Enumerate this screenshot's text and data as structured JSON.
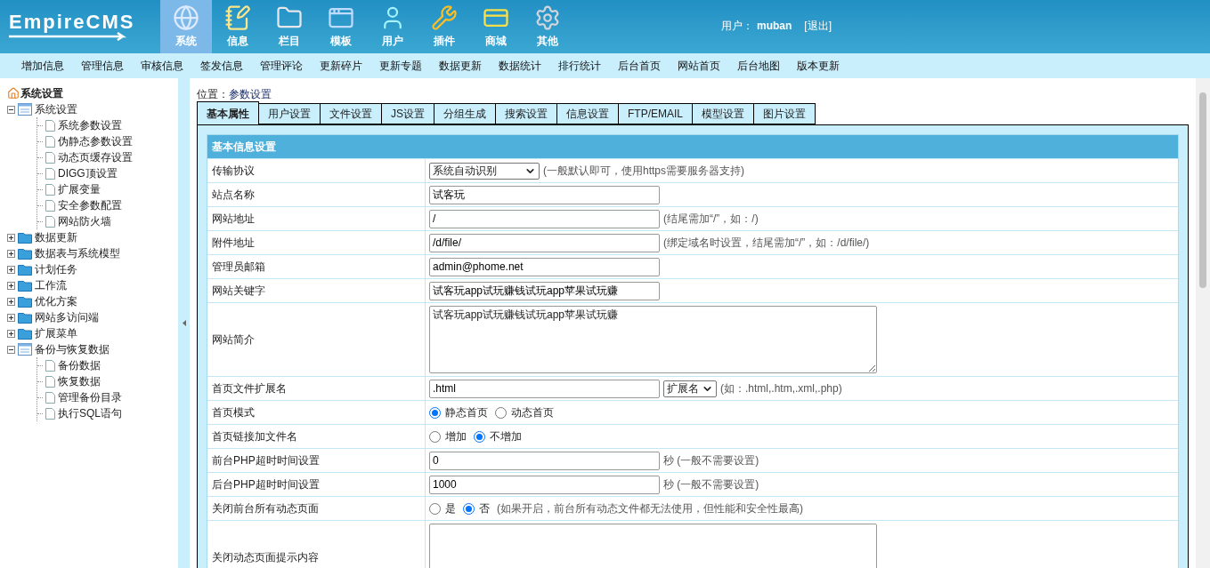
{
  "header": {
    "logo": "EmpireCMS",
    "nav": [
      {
        "label": "系统",
        "selected": true
      },
      {
        "label": "信息",
        "selected": false
      },
      {
        "label": "栏目",
        "selected": false
      },
      {
        "label": "模板",
        "selected": false
      },
      {
        "label": "用户",
        "selected": false
      },
      {
        "label": "插件",
        "selected": false
      },
      {
        "label": "商城",
        "selected": false
      },
      {
        "label": "其他",
        "selected": false
      }
    ],
    "user_label": "用户：",
    "user_name": "muban",
    "logout": "[退出]"
  },
  "submenu": [
    "增加信息",
    "管理信息",
    "审核信息",
    "签发信息",
    "管理评论",
    "更新碎片",
    "更新专题",
    "数据更新",
    "数据统计",
    "排行统计",
    "后台首页",
    "网站首页",
    "后台地图",
    "版本更新"
  ],
  "sidebar": {
    "title": "系统设置",
    "tree": [
      {
        "label": "系统设置",
        "expanded": true,
        "children": [
          {
            "label": "系统参数设置"
          },
          {
            "label": "伪静态参数设置"
          },
          {
            "label": "动态页缓存设置"
          },
          {
            "label": "DIGG顶设置"
          },
          {
            "label": "扩展变量"
          },
          {
            "label": "安全参数配置"
          },
          {
            "label": "网站防火墙"
          }
        ]
      },
      {
        "label": "数据更新",
        "expanded": false
      },
      {
        "label": "数据表与系统模型",
        "expanded": false
      },
      {
        "label": "计划任务",
        "expanded": false
      },
      {
        "label": "工作流",
        "expanded": false
      },
      {
        "label": "优化方案",
        "expanded": false
      },
      {
        "label": "网站多访问端",
        "expanded": false
      },
      {
        "label": "扩展菜单",
        "expanded": false
      },
      {
        "label": "备份与恢复数据",
        "expanded": true,
        "children": [
          {
            "label": "备份数据"
          },
          {
            "label": "恢复数据"
          },
          {
            "label": "管理备份目录"
          },
          {
            "label": "执行SQL语句"
          }
        ]
      }
    ]
  },
  "location": {
    "label": "位置：",
    "value": "参数设置"
  },
  "tabs": [
    {
      "label": "基本属性",
      "selected": true
    },
    {
      "label": "用户设置",
      "selected": false
    },
    {
      "label": "文件设置",
      "selected": false
    },
    {
      "label": "JS设置",
      "selected": false
    },
    {
      "label": "分组生成",
      "selected": false
    },
    {
      "label": "搜索设置",
      "selected": false
    },
    {
      "label": "信息设置",
      "selected": false
    },
    {
      "label": "FTP/EMAIL",
      "selected": false
    },
    {
      "label": "模型设置",
      "selected": false
    },
    {
      "label": "图片设置",
      "selected": false
    }
  ],
  "section_title": "基本信息设置",
  "rows": [
    {
      "kind": "select",
      "label": "传输协议",
      "value": "系统自动识别",
      "hint": "(一般默认即可，使用https需要服务器支持)"
    },
    {
      "kind": "text",
      "label": "站点名称",
      "value": "试客玩"
    },
    {
      "kind": "text",
      "label": "网站地址",
      "value": "/",
      "hint": "(结尾需加“/”，如：/)"
    },
    {
      "kind": "text",
      "label": "附件地址",
      "value": "/d/file/",
      "hint": "(绑定域名时设置，结尾需加“/”，如：/d/file/)"
    },
    {
      "kind": "text",
      "label": "管理员邮箱",
      "value": "admin@phome.net"
    },
    {
      "kind": "text",
      "label": "网站关键字",
      "value": "试客玩app试玩赚钱试玩app苹果试玩赚"
    },
    {
      "kind": "textarea",
      "label": "网站简介",
      "value": "试客玩app试玩赚钱试玩app苹果试玩赚"
    },
    {
      "kind": "text_select",
      "label": "首页文件扩展名",
      "value": ".html",
      "select": "扩展名",
      "hint": "(如：.html,.htm,.xml,.php)"
    },
    {
      "kind": "radio",
      "label": "首页模式",
      "options": [
        {
          "label": "静态首页",
          "selected": true
        },
        {
          "label": "动态首页",
          "selected": false
        }
      ]
    },
    {
      "kind": "radio",
      "label": "首页链接加文件名",
      "options": [
        {
          "label": "增加",
          "selected": false
        },
        {
          "label": "不增加",
          "selected": true
        }
      ]
    },
    {
      "kind": "text",
      "label": "前台PHP超时时间设置",
      "value": "0",
      "hint": "秒 (一般不需要设置)"
    },
    {
      "kind": "text",
      "label": "后台PHP超时时间设置",
      "value": "1000",
      "hint": "秒 (一般不需要设置)"
    },
    {
      "kind": "radio",
      "label": "关闭前台所有动态页面",
      "options": [
        {
          "label": "是",
          "selected": false
        },
        {
          "label": "否",
          "selected": true
        }
      ],
      "hint": "(如果开启，前台所有动态文件都无法使用，但性能和安全性最高)"
    },
    {
      "kind": "textarea",
      "label": "关闭动态页面提示内容",
      "value": ""
    }
  ]
}
